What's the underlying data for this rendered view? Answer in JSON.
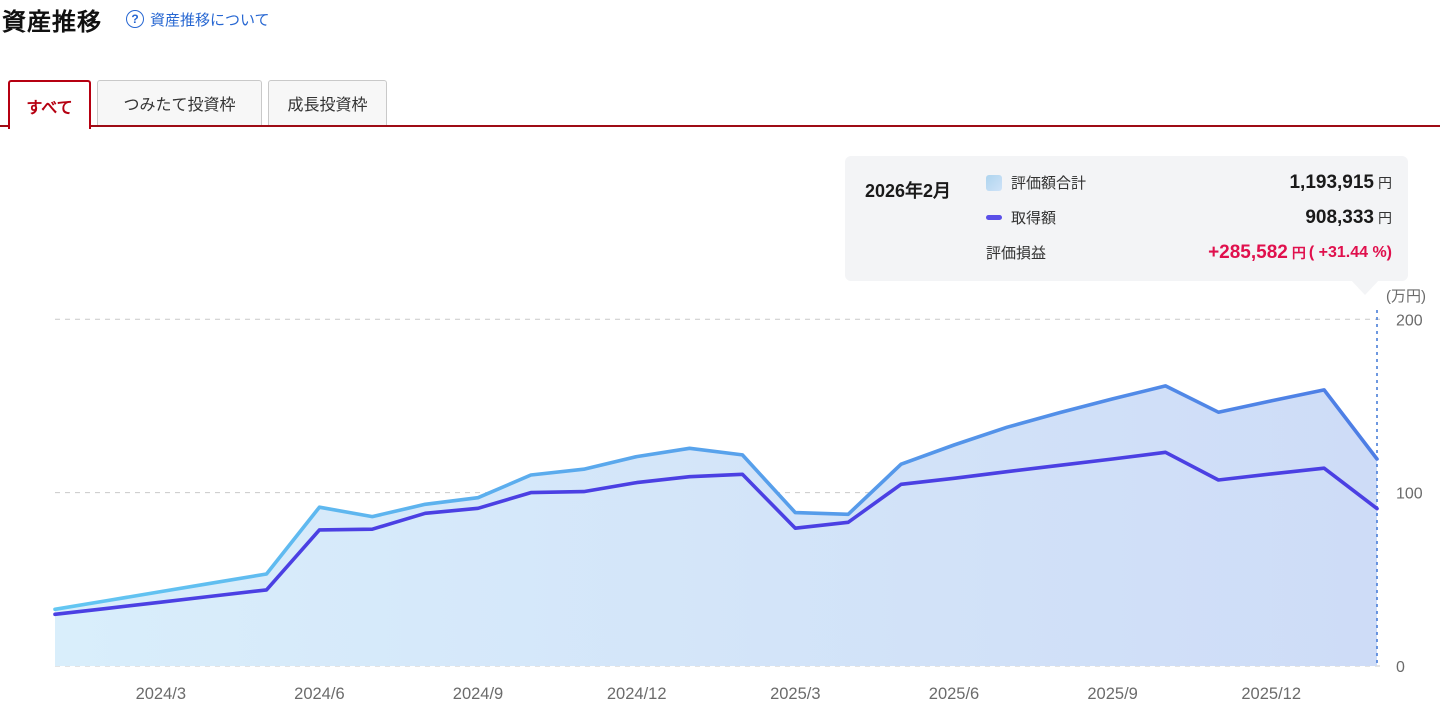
{
  "header": {
    "title": "資産推移",
    "help_link": "資産推移について",
    "help_glyph": "?"
  },
  "tabs": [
    {
      "label": "すべて",
      "active": true
    },
    {
      "label": "つみたて投資枠",
      "active": false
    },
    {
      "label": "成長投資枠",
      "active": false
    }
  ],
  "tooltip": {
    "date": "2026年2月",
    "rows": [
      {
        "label": "評価額合計",
        "value": "1,193,915",
        "unit": "円"
      },
      {
        "label": "取得額",
        "value": "908,333",
        "unit": "円"
      },
      {
        "label": "評価損益",
        "value": "+285,582",
        "unit": "円",
        "pct": "( +31.44 %)"
      }
    ]
  },
  "colors": {
    "accent_red": "#b60011",
    "underline_red": "#9e0c15",
    "link_blue": "#2767d2",
    "profit_pink": "#e0104d",
    "eval_line_start": "#63c7f2",
    "eval_line_end": "#4d7de5",
    "acq_line": "#4b40e3",
    "area_fill_start": "#d9eefb",
    "area_fill_end": "#cedcf7",
    "grid": "#c9c9c9",
    "cursor_line": "#4a7fd9",
    "tick_text": "#6b6b6b"
  },
  "chart_data": {
    "type": "area",
    "title": "資産推移",
    "x": [
      "2024/1",
      "2024/2",
      "2024/3",
      "2024/4",
      "2024/5",
      "2024/6",
      "2024/7",
      "2024/8",
      "2024/9",
      "2024/10",
      "2024/11",
      "2024/12",
      "2025/1",
      "2025/2",
      "2025/3",
      "2025/4",
      "2025/5",
      "2025/6",
      "2025/7",
      "2025/8",
      "2025/9",
      "2025/10",
      "2025/11",
      "2025/12",
      "2026/1",
      "2026/2"
    ],
    "series": [
      {
        "name": "評価額合計",
        "values": [
          32.7,
          37.8,
          42.9,
          48.0,
          53.1,
          91.6,
          86.2,
          93.3,
          97.1,
          110.2,
          113.5,
          120.8,
          125.6,
          121.8,
          88.5,
          87.5,
          116.4,
          127.5,
          137.7,
          146.2,
          154.1,
          161.6,
          146.4,
          152.9,
          159.3,
          119.4
        ]
      },
      {
        "name": "取得額",
        "values": [
          29.8,
          33.3,
          36.8,
          40.4,
          43.9,
          78.5,
          78.9,
          88.1,
          91.0,
          100.0,
          100.6,
          105.8,
          109.2,
          110.6,
          79.5,
          82.9,
          104.8,
          108.3,
          112.1,
          115.8,
          119.4,
          123.3,
          107.3,
          110.8,
          114.1,
          90.8
        ]
      }
    ],
    "x_ticks": [
      "2024/3",
      "2024/6",
      "2024/9",
      "2024/12",
      "2025/3",
      "2025/6",
      "2025/9",
      "2025/12"
    ],
    "y_ticks": [
      0,
      100,
      200
    ],
    "ylim": [
      0,
      200
    ],
    "y_unit": "(万円)",
    "grid": "dashed",
    "legend_position": "tooltip-top-right",
    "highlight_x": "2026/2"
  }
}
